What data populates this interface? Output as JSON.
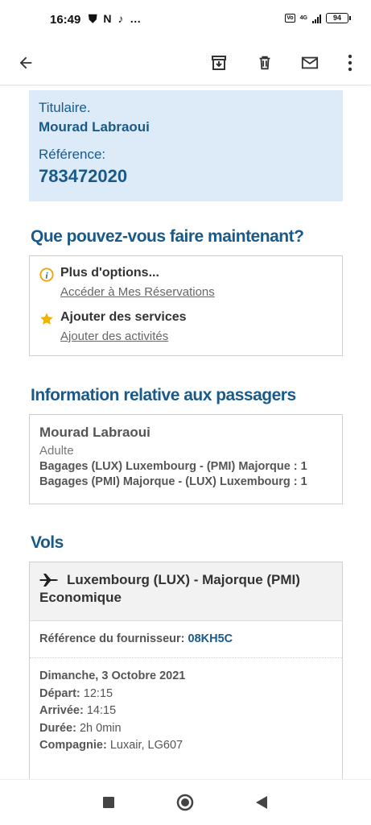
{
  "status": {
    "time": "16:49",
    "left_icons": "⛊ N ♪ …",
    "battery": "94",
    "network": "4G"
  },
  "holder": {
    "label": "Titulaire.",
    "name": "Mourad Labraoui",
    "ref_label": "Référence:",
    "ref_value": "783472020"
  },
  "options_section": {
    "title": "Que pouvez-vous faire maintenant?",
    "items": [
      {
        "title": "Plus d'options...",
        "link": "Accéder à Mes Réservations",
        "icon": "info-icon",
        "color": "#f0a000"
      },
      {
        "title": "Ajouter des services",
        "link": "Ajouter des activités",
        "icon": "star-icon",
        "color": "#f0b400"
      }
    ]
  },
  "passengers_section": {
    "title": "Information relative aux passagers",
    "name": "Mourad Labraoui",
    "type": "Adulte",
    "bags": [
      "Bagages (LUX) Luxembourg - (PMI) Majorque : 1",
      "Bagages (PMI) Majorque - (LUX) Luxembourg : 1"
    ]
  },
  "flights_section": {
    "title": "Vols",
    "route": "Luxembourg (LUX) - Majorque (PMI)",
    "class": "Economique",
    "supplier_label": "Référence du fournisseur:",
    "supplier_code": "08KH5C",
    "date": "Dimanche, 3 Octobre 2021",
    "depart_label": "Départ:",
    "depart": "12:15",
    "arrive_label": "Arrivée:",
    "arrive": "14:15",
    "duration_label": "Durée:",
    "duration": "2h 0min",
    "company_label": "Compagnie:",
    "company": "Luxair, LG607"
  },
  "colors": {
    "accent": "#1a5a8a",
    "holder_bg": "#dcebf7",
    "green": "#4e9a2a"
  }
}
